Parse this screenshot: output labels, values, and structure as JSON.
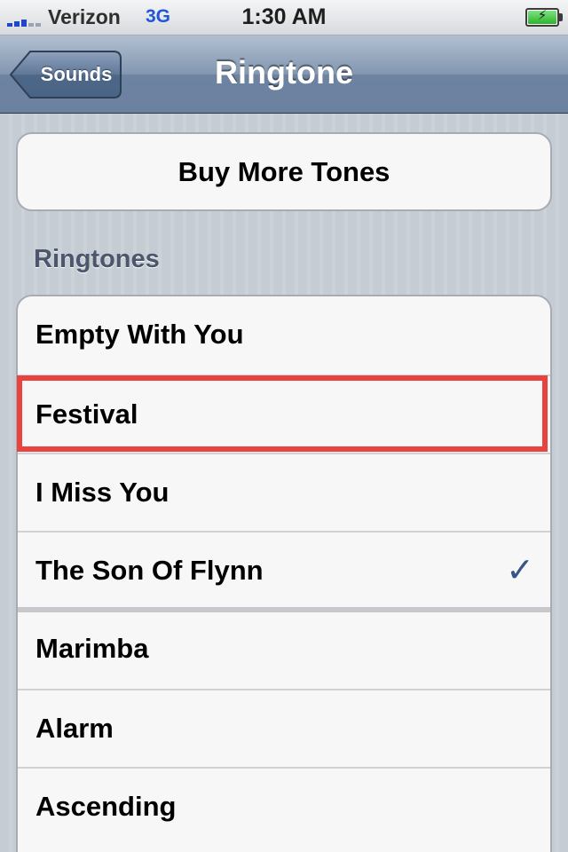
{
  "status_bar": {
    "carrier": "Verizon",
    "network": "3G",
    "time": "1:30 AM"
  },
  "nav": {
    "back_label": "Sounds",
    "title": "Ringtone"
  },
  "buy_button": {
    "label": "Buy More Tones"
  },
  "section": {
    "header": "Ringtones"
  },
  "ringtones": [
    {
      "label": "Empty With You",
      "selected": false
    },
    {
      "label": "Festival",
      "selected": false
    },
    {
      "label": "I Miss You",
      "selected": false
    },
    {
      "label": "The Son Of Flynn",
      "selected": true
    },
    {
      "label": "Marimba",
      "selected": false
    },
    {
      "label": "Alarm",
      "selected": false
    },
    {
      "label": "Ascending",
      "selected": false
    }
  ],
  "checkmark_glyph": "✓",
  "colors": {
    "nav_bar": "#6d83a1",
    "accent_check": "#385487",
    "highlight": "#e94340",
    "signal": "#1e48c8",
    "network": "#2256d8",
    "battery": "#2db32d"
  }
}
